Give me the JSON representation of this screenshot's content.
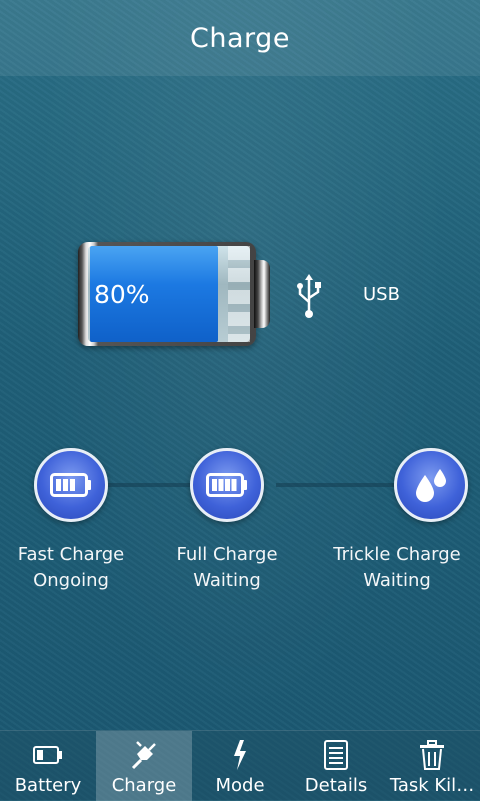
{
  "header": {
    "title": "Charge"
  },
  "battery": {
    "percent_text": "80%",
    "level": 0.8
  },
  "source": {
    "label": "USB",
    "icon": "usb-icon"
  },
  "stages": [
    {
      "name": "Fast Charge",
      "status": "Ongoing",
      "icon": "battery-low-icon"
    },
    {
      "name": "Full Charge",
      "status": "Waiting",
      "icon": "battery-full-icon"
    },
    {
      "name": "Trickle Charge",
      "status": "Waiting",
      "icon": "drops-icon"
    }
  ],
  "tabs": [
    {
      "label": "Battery",
      "icon": "battery-icon",
      "active": false
    },
    {
      "label": "Charge",
      "icon": "plug-icon",
      "active": true
    },
    {
      "label": "Mode",
      "icon": "lightning-icon",
      "active": false
    },
    {
      "label": "Details",
      "icon": "document-icon",
      "active": false
    },
    {
      "label": "Task Kil…",
      "icon": "trash-icon",
      "active": false
    }
  ],
  "colors": {
    "accent": "#1c79e2",
    "stage_circle": "#3f62d9"
  }
}
